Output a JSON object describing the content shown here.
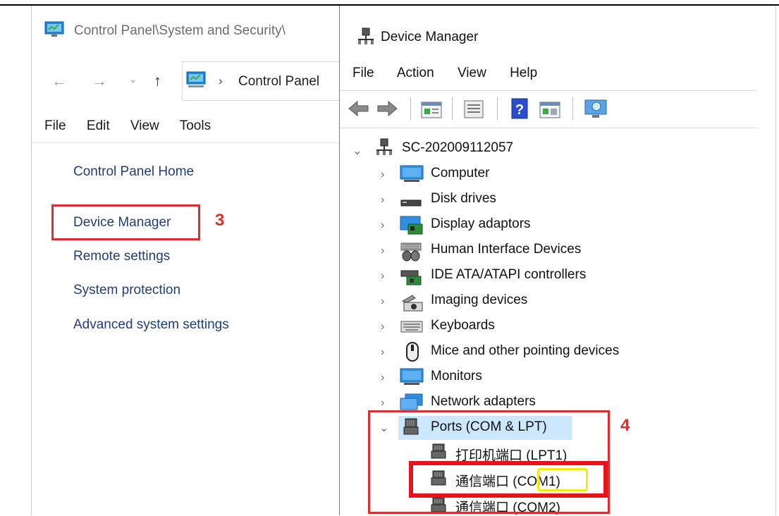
{
  "control_panel": {
    "title": "Control Panel\\System and Security\\",
    "address": "Control Panel",
    "menu": [
      "File",
      "Edit",
      "View",
      "Tools"
    ],
    "links": {
      "home": "Control Panel Home",
      "device_manager": "Device Manager",
      "remote": "Remote settings",
      "protection": "System protection",
      "advanced": "Advanced system settings"
    },
    "step_badge": "3"
  },
  "device_manager": {
    "title": "Device Manager",
    "menu": [
      "File",
      "Action",
      "View",
      "Help"
    ],
    "tree": {
      "root": "SC-202009112057",
      "categories": [
        {
          "label": "Computer",
          "icon": "monitor-icon"
        },
        {
          "label": "Disk drives",
          "icon": "disk-icon"
        },
        {
          "label": "Display adaptors",
          "icon": "display-adapter-icon"
        },
        {
          "label": "Human Interface Devices",
          "icon": "hid-icon"
        },
        {
          "label": "IDE ATA/ATAPI controllers",
          "icon": "ide-icon"
        },
        {
          "label": "Imaging devices",
          "icon": "imaging-icon"
        },
        {
          "label": "Keyboards",
          "icon": "keyboard-icon"
        },
        {
          "label": "Mice and other pointing devices",
          "icon": "mouse-icon"
        },
        {
          "label": "Monitors",
          "icon": "monitor-icon"
        },
        {
          "label": "Network adapters",
          "icon": "network-icon"
        }
      ],
      "ports": {
        "label": "Ports (COM & LPT)",
        "children": [
          {
            "name": "打印机端口",
            "port": "(LPT1)"
          },
          {
            "name": "通信端口",
            "port": "COM1"
          },
          {
            "name": "通信端口",
            "port": "(COM2)"
          }
        ]
      }
    },
    "step_badge": "4"
  }
}
